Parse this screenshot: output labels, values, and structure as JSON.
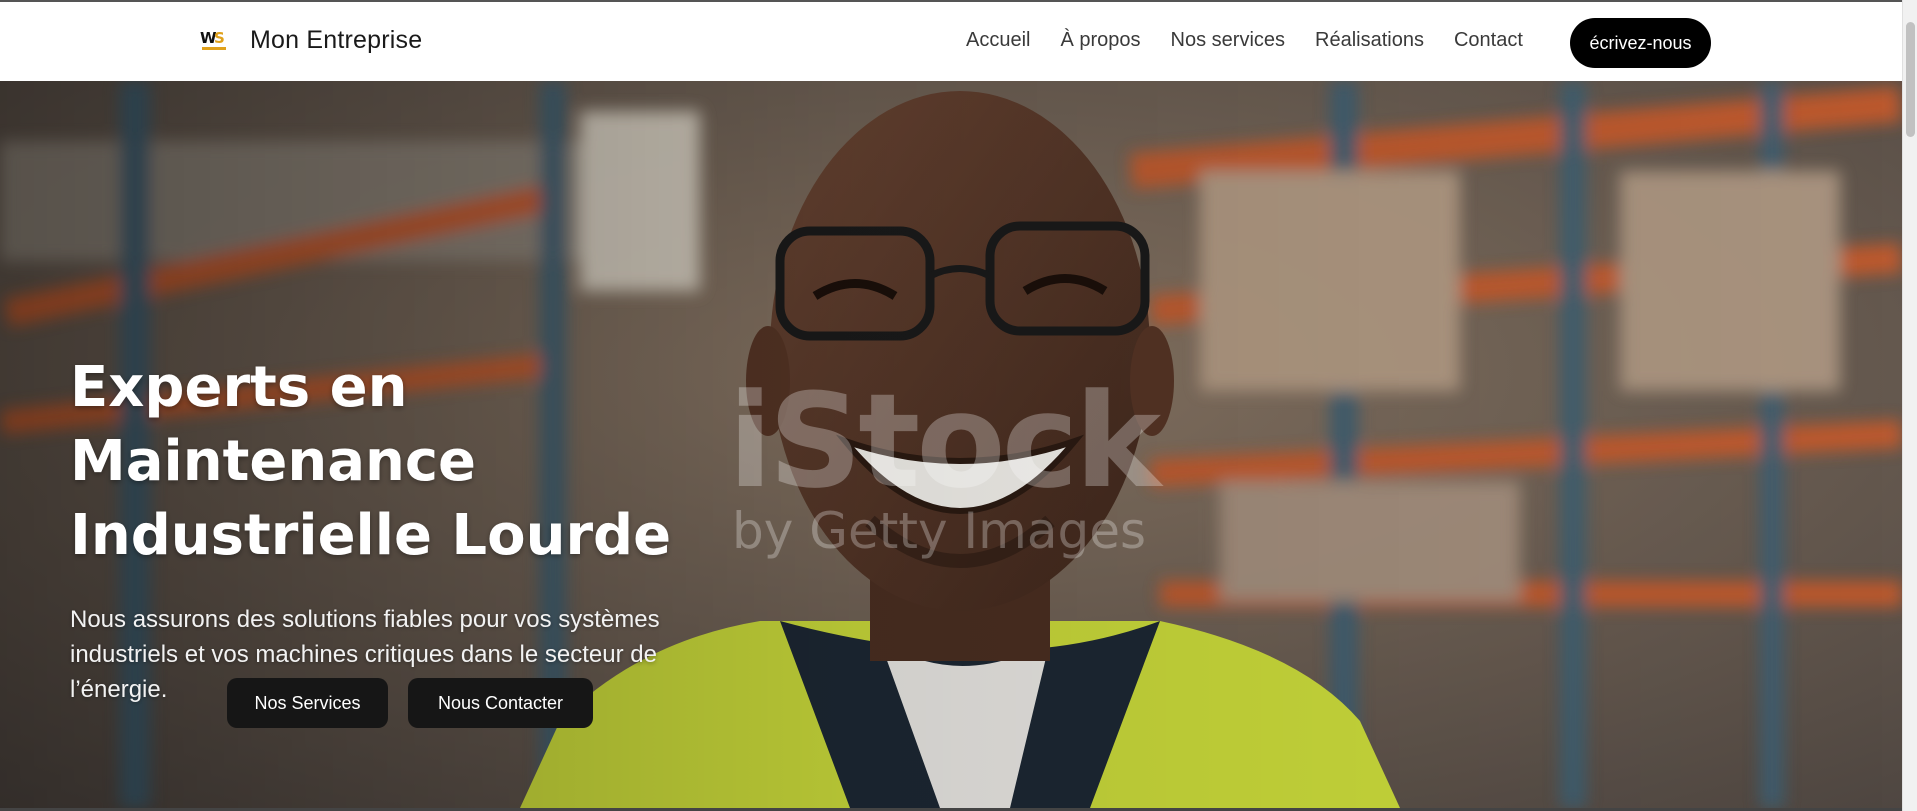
{
  "header": {
    "brand_name": "Mon Entreprise",
    "logo_icon": "ws-logo-icon",
    "nav": [
      "Accueil",
      "À propos",
      "Nos services",
      "Réalisations",
      "Contact"
    ],
    "cta_label": "écrivez-nous"
  },
  "hero": {
    "title": "Experts en\nMaintenance\nIndustrielle Lourde",
    "subtitle": "Nous assurons des solutions fiables pour vos systèmes industriels et vos machines critiques dans le secteur de l’énergie.",
    "buttons": {
      "services": "Nos Services",
      "contact": "Nous Contacter"
    },
    "watermark_main": "iStock",
    "watermark_sub": "by Getty Images"
  },
  "colors": {
    "accent": "#000000",
    "shelf_orange": "#c75a2a",
    "vest_yellow": "#c8d83a"
  }
}
